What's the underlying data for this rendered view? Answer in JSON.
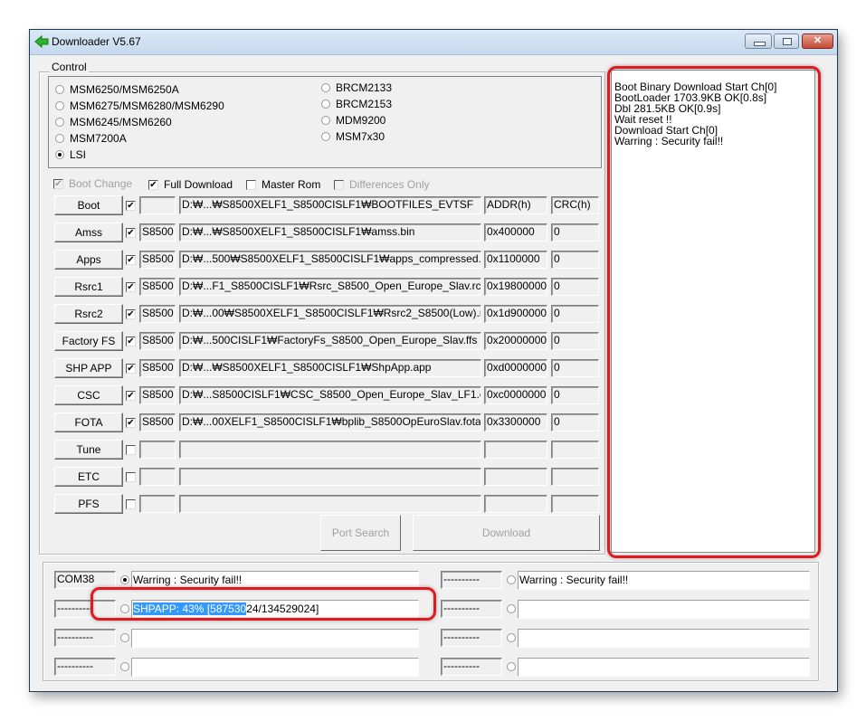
{
  "window": {
    "title": "Downloader V5.67",
    "icon": "green-arrow-icon",
    "controls": {
      "minimize": "minimize",
      "maximize": "maximize",
      "close": "close"
    }
  },
  "control": {
    "group_label": "Control",
    "chipsets_left": [
      {
        "label": "MSM6250/MSM6250A",
        "selected": false
      },
      {
        "label": "MSM6275/MSM6280/MSM6290",
        "selected": false
      },
      {
        "label": "MSM6245/MSM6260",
        "selected": false
      },
      {
        "label": "MSM7200A",
        "selected": false
      },
      {
        "label": "LSI",
        "selected": true
      }
    ],
    "chipsets_right": [
      {
        "label": "BRCM2133",
        "selected": false
      },
      {
        "label": "BRCM2153",
        "selected": false
      },
      {
        "label": "MDM9200",
        "selected": false
      },
      {
        "label": "MSM7x30",
        "selected": false
      }
    ],
    "options": [
      {
        "label": "Boot Change",
        "checked": true,
        "disabled": true
      },
      {
        "label": "Full Download",
        "checked": true,
        "disabled": false
      },
      {
        "label": "Master Rom",
        "checked": false,
        "disabled": false
      },
      {
        "label": "Differences Only",
        "checked": false,
        "disabled": true
      }
    ],
    "headers": {
      "addr": "ADDR(h)",
      "crc": "CRC(h)"
    },
    "files": [
      {
        "button": "Boot",
        "checked": true,
        "model": "",
        "path": "D:₩...₩S8500XELF1_S8500CISLF1₩BOOTFILES_EVTSF",
        "addr": "ADDR(h)",
        "crc": "CRC(h)"
      },
      {
        "button": "Amss",
        "checked": true,
        "model": "S8500",
        "path": "D:₩...₩S8500XELF1_S8500CISLF1₩amss.bin",
        "addr": "0x400000",
        "crc": "0"
      },
      {
        "button": "Apps",
        "checked": true,
        "model": "S8500",
        "path": "D:₩...500₩S8500XELF1_S8500CISLF1₩apps_compressed.",
        "addr": "0x1100000",
        "crc": "0"
      },
      {
        "button": "Rsrc1",
        "checked": true,
        "model": "S8500",
        "path": "D:₩...F1_S8500CISLF1₩Rsrc_S8500_Open_Europe_Slav.rc",
        "addr": "0x19800000",
        "crc": "0"
      },
      {
        "button": "Rsrc2",
        "checked": true,
        "model": "S8500",
        "path": "D:₩...00₩S8500XELF1_S8500CISLF1₩Rsrc2_S8500(Low).r",
        "addr": "0x1d900000",
        "crc": "0"
      },
      {
        "button": "Factory FS",
        "checked": true,
        "model": "S8500",
        "path": "D:₩...500CISLF1₩FactoryFs_S8500_Open_Europe_Slav.ffs",
        "addr": "0x20000000",
        "crc": "0"
      },
      {
        "button": "SHP APP",
        "checked": true,
        "model": "S8500",
        "path": "D:₩...₩S8500XELF1_S8500CISLF1₩ShpApp.app",
        "addr": "0xd0000000",
        "crc": "0"
      },
      {
        "button": "CSC",
        "checked": true,
        "model": "S8500",
        "path": "D:₩...S8500CISLF1₩CSC_S8500_Open_Europe_Slav_LF1.c",
        "addr": "0xc0000000",
        "crc": "0"
      },
      {
        "button": "FOTA",
        "checked": true,
        "model": "S8500",
        "path": "D:₩...00XELF1_S8500CISLF1₩bplib_S8500OpEuroSlav.fota",
        "addr": "0x3300000",
        "crc": "0"
      },
      {
        "button": "Tune",
        "checked": false,
        "model": "",
        "path": "",
        "addr": "",
        "crc": ""
      },
      {
        "button": "ETC",
        "checked": false,
        "model": "",
        "path": "",
        "addr": "",
        "crc": ""
      },
      {
        "button": "PFS",
        "checked": false,
        "model": "",
        "path": "",
        "addr": "",
        "crc": ""
      }
    ],
    "port_search_label": "Port Search",
    "download_label": "Download"
  },
  "log": {
    "lines": [
      "Boot Binary Download Start Ch[0]",
      "BootLoader 1703.9KB OK[0.8s]",
      "Dbl 281.5KB OK[0.9s]",
      "Wait reset !!",
      "Download Start Ch[0]",
      "Warring : Security fail!!"
    ]
  },
  "ports": {
    "left": [
      {
        "name": "COM38",
        "selected": true,
        "status": "Warring : Security fail!!"
      },
      {
        "name": "----------",
        "selected": false,
        "status_selected": "SHPAPP:  43% [587530",
        "status_rest": "24/134529024]",
        "progress_percent": 43
      },
      {
        "name": "----------",
        "selected": false,
        "status": ""
      },
      {
        "name": "----------",
        "selected": false,
        "status": ""
      }
    ],
    "right": [
      {
        "name": "----------",
        "selected": false,
        "status": "Warring : Security fail!!"
      },
      {
        "name": "----------",
        "selected": false,
        "status": ""
      },
      {
        "name": "----------",
        "selected": false,
        "status": ""
      },
      {
        "name": "----------",
        "selected": false,
        "status": ""
      }
    ]
  },
  "annotations": {
    "highlight_color": "#e0191f"
  }
}
